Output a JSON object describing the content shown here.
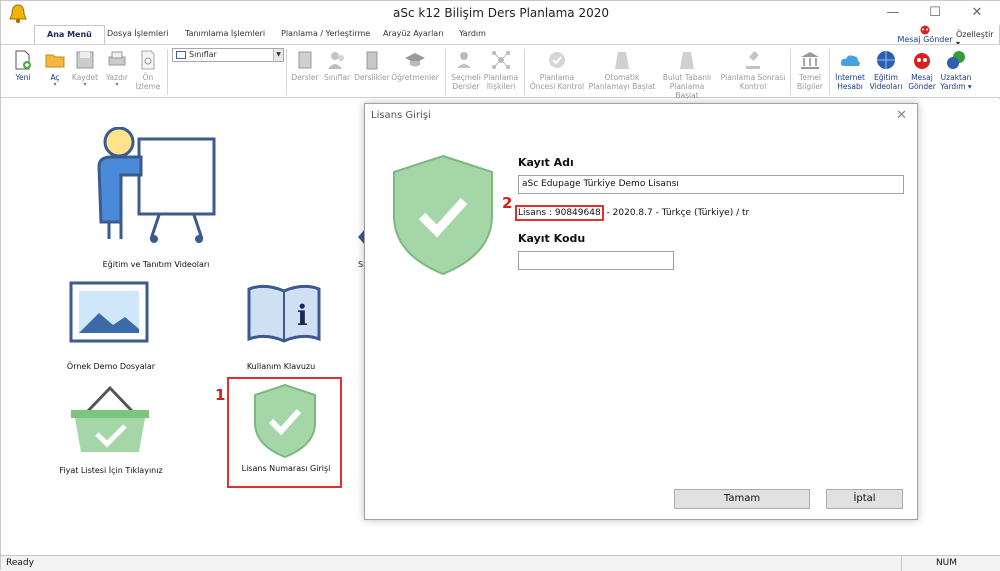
{
  "window": {
    "title": "aSc k12 Bilişim Ders Planlama 2020"
  },
  "tabs": [
    {
      "label": "Ana Menü",
      "active": true
    },
    {
      "label": "Dosya İşlemleri"
    },
    {
      "label": "Tanımlama İşlemleri"
    },
    {
      "label": "Planlama / Yerleştirme"
    },
    {
      "label": "Arayüz Ayarları"
    },
    {
      "label": "Yardım"
    }
  ],
  "top_right": {
    "message_send": "Mesaj Gönder",
    "customize": "Özelleştir"
  },
  "ribbon": {
    "new": "Yeni",
    "open": "Aç",
    "save": "Kaydet",
    "print": "Yazdır",
    "preview_l1": "Ön",
    "preview_l2": "İzleme",
    "combo_value": "Sınıflar",
    "subjects": "Dersler",
    "classes": "Sınıflar",
    "classrooms": "Derslikler",
    "teachers": "Öğretmenler",
    "elective_l1": "Seçmeli",
    "elective_l2": "Dersler",
    "planning_rel_l1": "Planlama",
    "planning_rel_l2": "İlişkileri",
    "pre_check_l1": "Planlama",
    "pre_check_l2": "Öncesi Kontrol",
    "auto_plan_l1": "Otomatik",
    "auto_plan_l2": "Planlamayı Başlat",
    "cloud_plan_l1": "Bulut Tabanlı",
    "cloud_plan_l2": "Planlama Başlat",
    "post_check_l1": "Planlama Sonrası",
    "post_check_l2": "Kontrol",
    "basic_info_l1": "Temel",
    "basic_info_l2": "Bilgiler",
    "internet_l1": "İnternet",
    "internet_l2": "Hesabı",
    "training_l1": "Eğitim",
    "training_l2": "Videoları",
    "msg_l1": "Mesaj",
    "msg_l2": "Gönder",
    "remote_l1": "Uzaktan",
    "remote_l2": "Yardım"
  },
  "main": {
    "tile_videos": "Eğitim ve Tanıtım Videoları",
    "tile_demo": "Örnek Demo Dosyalar",
    "tile_manual": "Kullanım Klavuzu",
    "tile_price": "Fiyat Listesi İçin Tıklayınız",
    "tile_license": "Lisans Numarası Girişi",
    "tile_partial": "Si",
    "annotation_1": "1",
    "annotation_2": "2"
  },
  "dialog": {
    "title": "Lisans Girişi",
    "reg_name_label": "Kayıt Adı",
    "reg_name_value": "aSc Edupage Türkiye Demo Lisansı",
    "license_number": "Lisans : 90849648",
    "license_rest": "- 2020.8.7 - Türkçe (Türkiye) / tr",
    "reg_code_label": "Kayıt Kodu",
    "reg_code_value": "",
    "ok": "Tamam",
    "cancel": "İptal"
  },
  "status": {
    "left": "Ready",
    "num": "NUM"
  },
  "colors": {
    "shield": "#a5d6a7",
    "shield_stroke": "#7cb87f",
    "annotation_red": "#e03030",
    "link_blue": "#1a3c8a"
  }
}
